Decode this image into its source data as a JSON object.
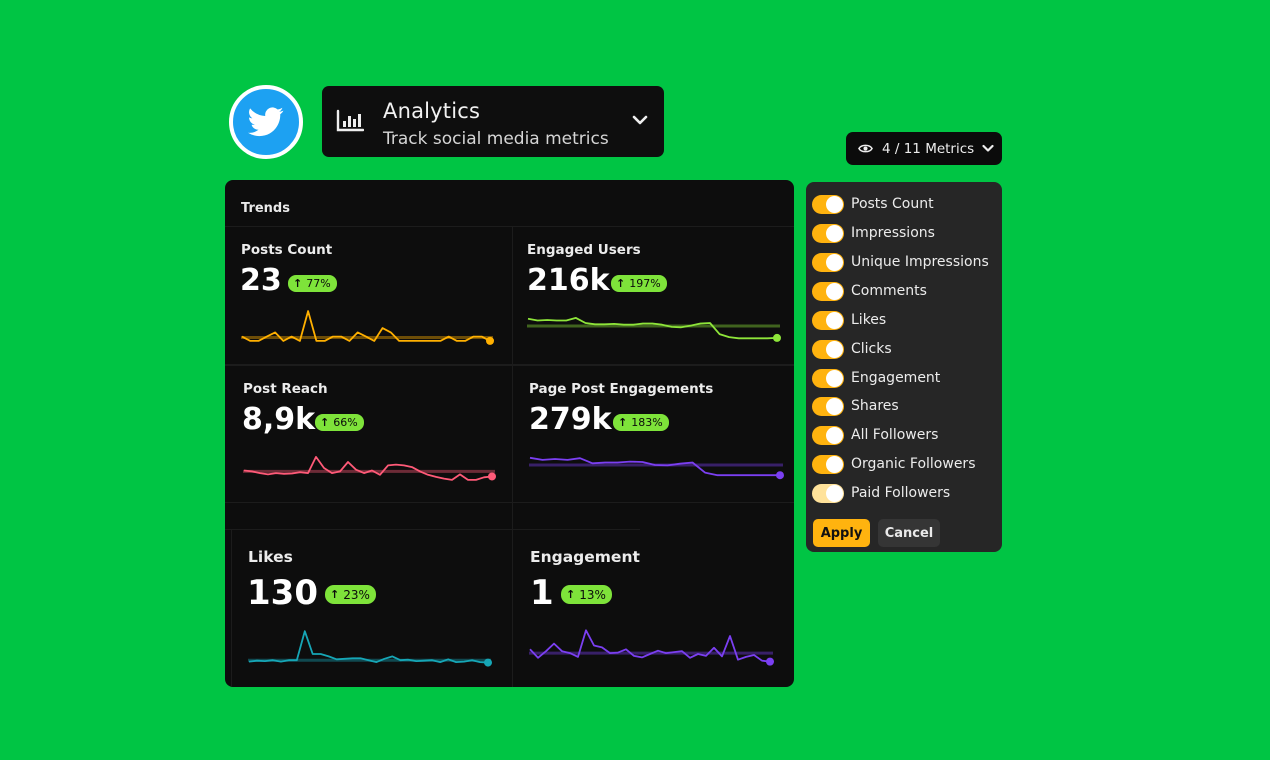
{
  "brand": {
    "name": "Twitter",
    "logo_icon": "twitter-bird-icon",
    "color": "#1da1f2"
  },
  "app_switcher": {
    "icon": "bar-chart-icon",
    "title": "Analytics",
    "subtitle": "Track social media metrics",
    "chevron_icon": "chevron-down-icon"
  },
  "metrics_button": {
    "icon": "eye-icon",
    "label": "4 / 11 Metrics",
    "chevron_icon": "chevron-down-icon"
  },
  "trends": {
    "title": "Trends",
    "cards": [
      {
        "label": "Posts Count",
        "value": "23",
        "change": "77%",
        "direction": "up",
        "color": "#ffb000",
        "series": [
          4,
          3,
          3,
          4,
          5,
          3,
          4,
          3,
          10,
          3,
          3,
          4,
          4,
          3,
          5,
          4,
          3,
          6,
          5,
          3,
          3,
          3,
          3,
          3,
          3,
          4,
          3,
          3,
          4,
          4,
          3
        ],
        "baseline": 3.8
      },
      {
        "label": "Engaged Users",
        "value": "216k",
        "change": "197%",
        "direction": "up",
        "color": "#8ee53a",
        "series": [
          8.2,
          7.8,
          7.9,
          7.8,
          7.8,
          8.4,
          7.2,
          6.9,
          6.9,
          7.0,
          6.8,
          6.8,
          7.1,
          7.1,
          6.8,
          6.3,
          6.2,
          6.6,
          7.1,
          7.2,
          4.6,
          3.9,
          3.6,
          3.6,
          3.6,
          3.6,
          3.7
        ],
        "baseline": 6.5
      },
      {
        "label": "Post Reach",
        "value": "8,9k",
        "change": "66%",
        "direction": "up",
        "color": "#ff5a78",
        "series": [
          5.2,
          5.0,
          4.6,
          4.3,
          4.6,
          4.4,
          4.5,
          4.8,
          4.6,
          8.4,
          5.8,
          4.6,
          5.0,
          7.2,
          5.4,
          4.6,
          5.2,
          4.2,
          6.4,
          6.6,
          6.4,
          6.0,
          5.0,
          4.2,
          3.7,
          3.3,
          3.0,
          4.3,
          3.0,
          3.0,
          3.6,
          3.8
        ],
        "baseline": 5.0
      },
      {
        "label": "Page Post Engagements",
        "value": "279k",
        "change": "183%",
        "direction": "up",
        "color": "#7b3ff2",
        "series": [
          8.2,
          7.7,
          7.9,
          7.7,
          8.1,
          6.9,
          7.1,
          7.1,
          7.3,
          7.2,
          6.5,
          6.4,
          6.8,
          7.1,
          4.7,
          4.1,
          4.1,
          4.1,
          4.1,
          4.1,
          4.1
        ],
        "baseline": 6.5
      },
      {
        "label": "Likes",
        "value": "130",
        "change": "23%",
        "direction": "up",
        "color": "#16a6b6",
        "series": [
          3.0,
          3.2,
          3.1,
          3.3,
          3.0,
          3.3,
          3.3,
          9.4,
          4.6,
          4.6,
          4.1,
          3.5,
          3.6,
          3.7,
          3.7,
          3.3,
          2.9,
          3.6,
          4.1,
          3.3,
          3.4,
          3.1,
          3.2,
          3.3,
          2.9,
          3.5,
          2.9,
          3.0,
          3.3,
          2.9,
          2.8
        ],
        "baseline": 3.3
      },
      {
        "label": "Engagement",
        "value": "1",
        "change": "13%",
        "direction": "up",
        "color": "#7b3ff2",
        "series": [
          5.6,
          3.8,
          5.2,
          6.8,
          5.2,
          4.8,
          4.0,
          9.6,
          6.4,
          6.0,
          4.8,
          4.9,
          5.6,
          4.2,
          3.9,
          4.6,
          5.3,
          4.8,
          5.0,
          5.2,
          3.8,
          4.6,
          4.2,
          5.9,
          4.1,
          8.4,
          3.4,
          4.0,
          4.4,
          3.2,
          3.0
        ],
        "baseline": 4.8
      }
    ]
  },
  "metrics_dropdown": {
    "items": [
      {
        "label": "Posts Count",
        "enabled": true
      },
      {
        "label": "Impressions",
        "enabled": true
      },
      {
        "label": "Unique Impressions",
        "enabled": true
      },
      {
        "label": "Comments",
        "enabled": true
      },
      {
        "label": "Likes",
        "enabled": true
      },
      {
        "label": "Clicks",
        "enabled": true
      },
      {
        "label": "Engagement",
        "enabled": true
      },
      {
        "label": "Shares",
        "enabled": true
      },
      {
        "label": "All Followers",
        "enabled": true
      },
      {
        "label": "Organic Followers",
        "enabled": true
      },
      {
        "label": "Paid Followers",
        "enabled": true,
        "hover": true
      }
    ],
    "apply_label": "Apply",
    "cancel_label": "Cancel",
    "accent_color": "#ffb30f"
  }
}
